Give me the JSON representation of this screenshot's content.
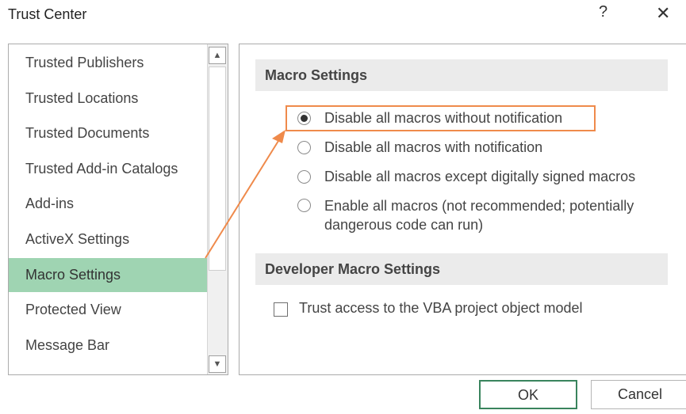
{
  "window": {
    "title": "Trust Center",
    "help_glyph": "?",
    "close_glyph": "✕"
  },
  "sidebar": {
    "items": [
      {
        "label": "Trusted Publishers",
        "selected": false
      },
      {
        "label": "Trusted Locations",
        "selected": false
      },
      {
        "label": "Trusted Documents",
        "selected": false
      },
      {
        "label": "Trusted Add-in Catalogs",
        "selected": false
      },
      {
        "label": "Add-ins",
        "selected": false
      },
      {
        "label": "ActiveX Settings",
        "selected": false
      },
      {
        "label": "Macro Settings",
        "selected": true
      },
      {
        "label": "Protected View",
        "selected": false
      },
      {
        "label": "Message Bar",
        "selected": false
      }
    ],
    "scroll_up_glyph": "▲",
    "scroll_down_glyph": "▼"
  },
  "macro_settings": {
    "header": "Macro Settings",
    "options": [
      {
        "label": "Disable all macros without notification",
        "checked": true
      },
      {
        "label": "Disable all macros with notification",
        "checked": false
      },
      {
        "label": "Disable all macros except digitally signed macros",
        "checked": false
      },
      {
        "label": "Enable all macros (not recommended; potentially dangerous code can run)",
        "checked": false
      }
    ]
  },
  "developer_settings": {
    "header": "Developer Macro Settings",
    "checkbox_label": "Trust access to the VBA project object model",
    "checked": false
  },
  "buttons": {
    "ok": "OK",
    "cancel": "Cancel"
  },
  "colors": {
    "selected_item": "#9fd4b2",
    "annotation": "#ef8a4b",
    "ok_border": "#39845d",
    "section_header_bg": "#ebebeb"
  }
}
